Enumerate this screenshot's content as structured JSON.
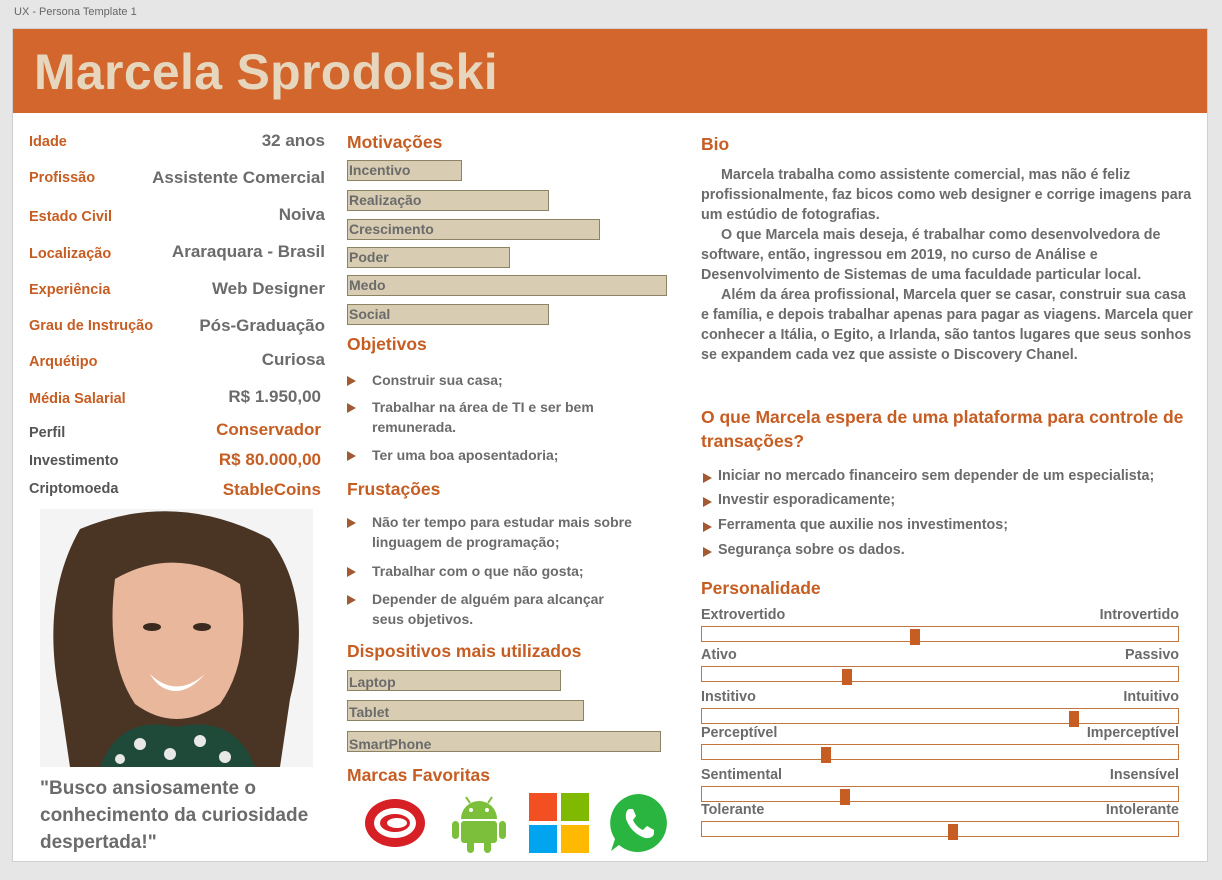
{
  "window": {
    "title": "UX - Persona Template 1"
  },
  "persona": {
    "name": "Marcela Sprodolski"
  },
  "facts": [
    {
      "key": "Idade",
      "value": "32 anos"
    },
    {
      "key": "Profissão",
      "value": "Assistente Comercial"
    },
    {
      "key": "Estado Civil",
      "value": "Noiva"
    },
    {
      "key": "Localização",
      "value": "Araraquara - Brasil"
    },
    {
      "key": "Experiência",
      "value": "Web Designer"
    },
    {
      "key": "Grau de Instrução",
      "value": "Pós-Graduação"
    },
    {
      "key": "Arquétipo",
      "value": "Curiosa"
    },
    {
      "key": "Média Salarial",
      "value": "R$ 1.950,00"
    }
  ],
  "investor": [
    {
      "key": "Perfil",
      "value": "Conservador"
    },
    {
      "key": "Investimento",
      "value": "R$ 80.000,00"
    },
    {
      "key": "Criptomoeda",
      "value": "StableCoins"
    }
  ],
  "quote": "\"Busco ansiosamente o conhecimento da curiosidade despertada!\"",
  "motivations": {
    "title": "Motivações",
    "items": [
      {
        "label": "Incentivo",
        "level": 0.36
      },
      {
        "label": "Realização",
        "level": 0.63
      },
      {
        "label": "Crescimento",
        "level": 0.79
      },
      {
        "label": "Poder",
        "level": 0.51
      },
      {
        "label": "Medo",
        "level": 1.0
      },
      {
        "label": "Social",
        "level": 0.63
      }
    ]
  },
  "objectives": {
    "title": "Objetivos",
    "items": [
      "Construir sua casa;",
      "Trabalhar  na área de TI e ser bem remunerada.",
      "Ter uma boa aposentadoria;"
    ]
  },
  "frustrations": {
    "title": "Frustações",
    "items": [
      "Não ter tempo para estudar mais sobre linguagem de programação;",
      "Trabalhar com o que não gosta;",
      "Depender de alguém para alcançar seus objetivos."
    ]
  },
  "devices": {
    "title": "Dispositivos mais utilizados",
    "items": [
      {
        "label": "Laptop",
        "level": 0.67
      },
      {
        "label": "Tablet",
        "level": 0.74
      },
      {
        "label": "SmartPhone",
        "level": 0.98
      }
    ]
  },
  "brands": {
    "title": "Marcas Favoritas",
    "items": [
      "adobe-creative-cloud-icon",
      "android-icon",
      "microsoft-icon",
      "whatsapp-icon"
    ]
  },
  "bio": {
    "title": "Bio",
    "paragraphs": [
      "Marcela trabalha como assistente comercial, mas não é feliz profissionalmente, faz bicos como web designer e corrige imagens para um estúdio de fotografias.",
      "O que Marcela mais deseja, é trabalhar como desenvolvedora de software, então, ingressou em 2019, no curso de Análise e Desenvolvimento de Sistemas de uma faculdade particular local.",
      "Além da área profissional, Marcela quer se casar, construir sua casa e família, e depois trabalhar apenas para pagar as viagens. Marcela quer conhecer a Itália, o Egito, a Irlanda, são tantos lugares que seus sonhos se expandem cada vez que assiste o Discovery Chanel."
    ]
  },
  "expectations": {
    "title": "O que Marcela espera de uma plataforma para controle de transações?",
    "items": [
      "Iniciar no mercado financeiro sem depender de um especialista;",
      "Investir esporadicamente;",
      "Ferramenta que auxilie nos investimentos;",
      "Segurança sobre os dados."
    ]
  },
  "personality": {
    "title": "Personalidade",
    "traits": [
      {
        "left": "Extrovertido",
        "right": "Introvertido",
        "level": 0.445
      },
      {
        "left": "Ativo",
        "right": "Passivo",
        "level": 0.3
      },
      {
        "left": "Institivo",
        "right": "Intuitivo",
        "level": 0.785
      },
      {
        "left": "Perceptível",
        "right": "Imperceptível",
        "level": 0.255
      },
      {
        "left": "Sentimental",
        "right": "Insensível",
        "level": 0.295
      },
      {
        "left": "Tolerante",
        "right": "Intolerante",
        "level": 0.525
      }
    ]
  },
  "colors": {
    "accent": "#d2662c",
    "name": "#e6d6bd",
    "bar": "#d8ccb2"
  }
}
